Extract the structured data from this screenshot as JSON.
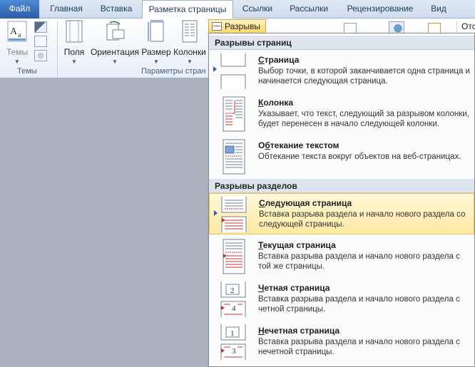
{
  "tabs": [
    {
      "label": "Файл"
    },
    {
      "label": "Главная"
    },
    {
      "label": "Вставка"
    },
    {
      "label": "Разметка страницы"
    },
    {
      "label": "Ссылки"
    },
    {
      "label": "Рассылки"
    },
    {
      "label": "Рецензирование"
    },
    {
      "label": "Вид"
    }
  ],
  "ribbon": {
    "themes_label": "Темы",
    "themes_group_label": "Темы",
    "margins_label": "Поля",
    "orientation_label": "Ориентация",
    "size_label": "Размер",
    "columns_label": "Колонки",
    "page_setup_group_label": "Параметры стран",
    "breaks_label": "Разрывы",
    "right_partial": "Отс"
  },
  "menu": {
    "page_breaks_header": "Разрывы страниц",
    "section_breaks_header": "Разрывы разделов",
    "items": [
      {
        "title_ul": "С",
        "title_rest": "траница",
        "desc": "Выбор точки, в которой заканчивается одна страница и начинается следующая страница."
      },
      {
        "title_ul": "К",
        "title_rest": "олонка",
        "desc": "Указывает, что текст, следующий за разрывом колонки, будет перенесен в начало следующей колонки."
      },
      {
        "title_pre": "О",
        "title_ul": "б",
        "title_rest": "текание текстом",
        "desc": "Обтекание текста вокруг объектов на веб-страницах."
      },
      {
        "title_ul": "С",
        "title_rest": "ледующая страница",
        "desc": "Вставка разрыва раздела и начало нового раздела со следующей страницы."
      },
      {
        "title_ul": "Т",
        "title_rest": "екущая страница",
        "desc": "Вставка разрыва раздела и начало нового раздела с той же страницы."
      },
      {
        "title_ul": "Ч",
        "title_rest": "етная страница",
        "desc": "Вставка разрыва раздела и начало нового раздела с четной страницы."
      },
      {
        "title_ul": "Н",
        "title_rest": "ечетная страница",
        "desc": "Вставка разрыва раздела и начало нового раздела с нечетной страницы."
      }
    ],
    "even_icon_numbers": [
      "2",
      "4"
    ],
    "odd_icon_numbers": [
      "1",
      "3"
    ]
  },
  "colors": {
    "accent": "#2a5ea8",
    "highlight": "#ffe9a3",
    "break_line": "#c03030"
  }
}
